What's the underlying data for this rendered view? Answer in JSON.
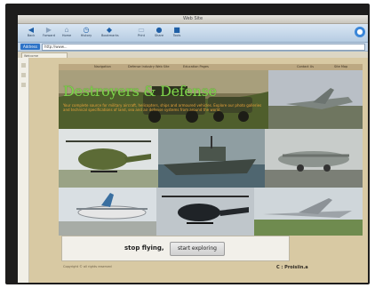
{
  "window": {
    "title": "Web Site"
  },
  "toolbar": {
    "items": [
      {
        "icon": "back-icon",
        "label": "Back"
      },
      {
        "icon": "forward-icon",
        "label": "Forward"
      },
      {
        "icon": "home-icon",
        "label": "Home"
      },
      {
        "icon": "history-icon",
        "label": "History"
      },
      {
        "icon": "bookmark-icon",
        "label": "Bookmarks"
      },
      {
        "icon": "print-icon",
        "label": "Print"
      },
      {
        "icon": "share-icon",
        "label": "Share"
      },
      {
        "icon": "settings-icon",
        "label": "Tools"
      }
    ]
  },
  "address": {
    "label": "Address",
    "value": "http://www..."
  },
  "tab": {
    "label": "Welcome"
  },
  "page": {
    "nav": [
      "Navigation",
      "Defense Industry Web Site",
      "Education Pages",
      "Contact Us",
      "Site Map"
    ],
    "headline": "Destroyers & Defense",
    "body": "Your complete source for military aircraft, helicopters, ships and armoured vehicles. Explore our photo galleries and technical specifications of land, sea and air defense systems from around the world.",
    "action": {
      "stop_label": "stop flying,",
      "start_label": "start exploring"
    },
    "footer_left": "Copyright © all rights reserved",
    "footer_right": "C : Proisiin.a"
  },
  "colors": {
    "headline": "#7fd34c",
    "body_text": "#e8a23a",
    "page_bg": "#d8c9a3",
    "toolbar": "#c4d6ea"
  },
  "images": [
    {
      "name": "armored-vehicle-photo"
    },
    {
      "name": "fighter-jet-photo"
    },
    {
      "name": "attack-helicopter-photo"
    },
    {
      "name": "patrol-boat-photo"
    },
    {
      "name": "transport-aircraft-photo"
    },
    {
      "name": "turboprop-plane-photo"
    },
    {
      "name": "black-helicopter-photo"
    },
    {
      "name": "delta-wing-jet-photo"
    }
  ]
}
